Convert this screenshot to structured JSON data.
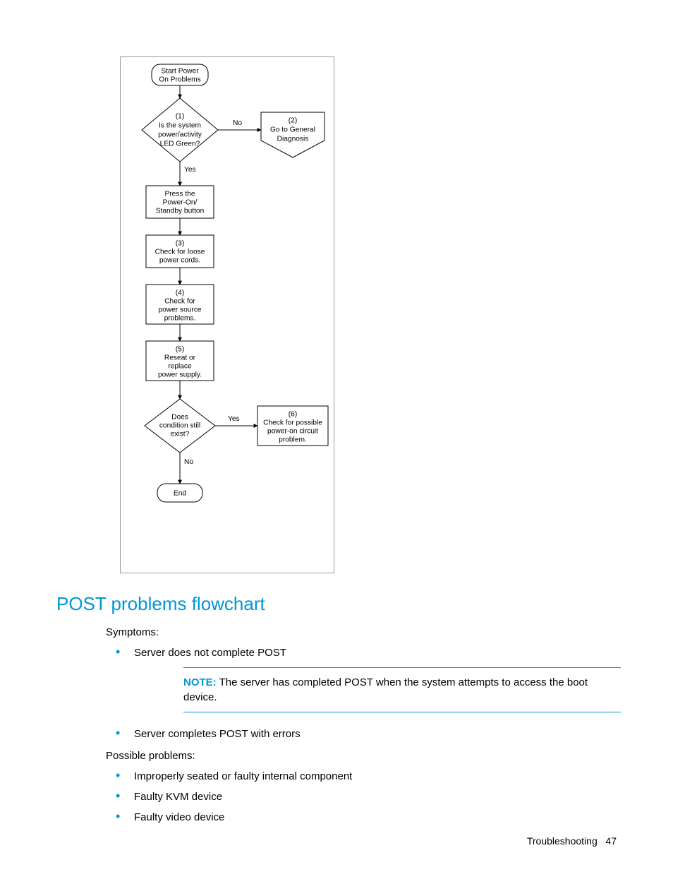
{
  "flowchart": {
    "start": "Start Power On Problems",
    "decision1": {
      "num": "(1)",
      "l1": "Is the system",
      "l2": "power/activity",
      "l3": "LED Green?",
      "yes": "Yes",
      "no": "No"
    },
    "offpage2": {
      "num": "(2)",
      "l1": "Go to General",
      "l2": "Diagnosis"
    },
    "proc_press": {
      "l1": "Press the",
      "l2": "Power-On/",
      "l3": "Standby button"
    },
    "proc3": {
      "num": "(3)",
      "l1": "Check for loose",
      "l2": "power cords."
    },
    "proc4": {
      "num": "(4)",
      "l1": "Check for",
      "l2": "power source",
      "l3": "problems."
    },
    "proc5": {
      "num": "(5)",
      "l1": "Reseat or",
      "l2": "replace",
      "l3": "power supply."
    },
    "decision2": {
      "l1": "Does",
      "l2": "condition still",
      "l3": "exist?",
      "yes": "Yes",
      "no": "No"
    },
    "proc6": {
      "num": "(6)",
      "l1": "Check for possible",
      "l2": "power-on circuit",
      "l3": "problem."
    },
    "end": "End"
  },
  "heading": "POST problems flowchart",
  "symptoms_label": "Symptoms:",
  "symptom1": "Server does not complete POST",
  "note_label": "NOTE:",
  "note_text": "  The server has completed POST when the system attempts to access the boot device.",
  "symptom2": "Server completes POST with errors",
  "possible_label": "Possible problems:",
  "pp1": "Improperly seated or faulty internal component",
  "pp2": "Faulty KVM device",
  "pp3": "Faulty video device",
  "footer_section": "Troubleshooting",
  "footer_page": "47"
}
